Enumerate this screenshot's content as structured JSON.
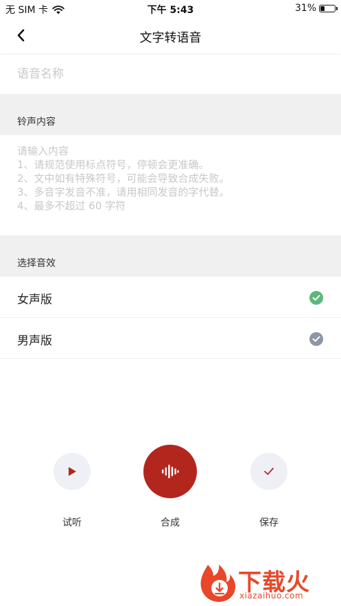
{
  "status_bar": {
    "carrier": "无 SIM 卡",
    "time": "下午 5:43",
    "battery": "31%",
    "battery_level": 0.31
  },
  "nav": {
    "title": "文字转语音"
  },
  "name_field": {
    "placeholder": "语音名称"
  },
  "ringtone_section": {
    "header": "铃声内容",
    "placeholder_lines": [
      "请输入内容",
      "1、请规范使用标点符号，停顿会更准确。",
      "2、文中如有特殊符号，可能会导致合成失败。",
      "3、多音字发音不准，请用相同发音的字代替。",
      "4、最多不超过 60 字符"
    ]
  },
  "effect_section": {
    "header": "选择音效",
    "options": [
      {
        "label": "女声版",
        "selected": true,
        "check_color": "#5cb87a"
      },
      {
        "label": "男声版",
        "selected": false,
        "check_color": "#8e96a3"
      }
    ]
  },
  "actions": {
    "listen": "试听",
    "synthesize": "合成",
    "save": "保存",
    "accent_color": "#b3261e"
  },
  "watermark": {
    "text": "下载火",
    "sub": "xiazaihuo.com"
  }
}
